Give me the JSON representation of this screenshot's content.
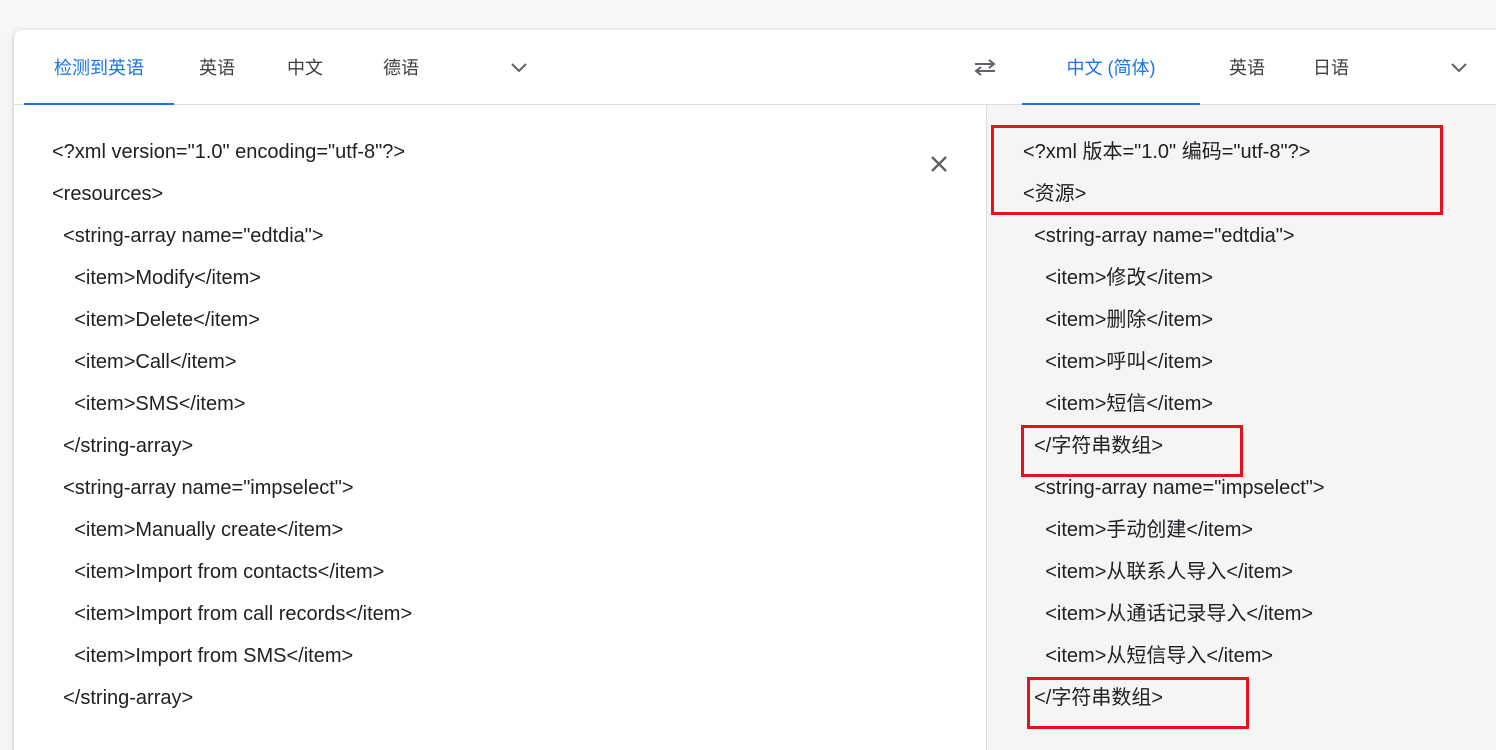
{
  "source_tabs": [
    "检测到英语",
    "英语",
    "中文",
    "德语"
  ],
  "target_tabs": [
    "中文 (简体)",
    "英语",
    "日语"
  ],
  "icons": {
    "source_more": "chevron-down-icon",
    "target_more": "chevron-down-icon",
    "swap": "swap-arrows-icon",
    "clear": "close-icon"
  },
  "colors": {
    "accent": "#1a73e8",
    "highlight": "#e8101a",
    "target_bg": "#f5f5f5"
  },
  "source_lines": [
    "<?xml version=\"1.0\" encoding=\"utf-8\"?>",
    "<resources>",
    "  <string-array name=\"edtdia\">",
    "    <item>Modify</item>",
    "    <item>Delete</item>",
    "    <item>Call</item>",
    "    <item>SMS</item>",
    "  </string-array>",
    "  <string-array name=\"impselect\">",
    "    <item>Manually create</item>",
    "    <item>Import from contacts</item>",
    "    <item>Import from call records</item>",
    "    <item>Import from SMS</item>",
    "  </string-array>"
  ],
  "target_lines": [
    "<?xml 版本=\"1.0\" 编码=\"utf-8\"?>",
    "<资源>",
    "  <string-array name=\"edtdia\">",
    "    <item>修改</item>",
    "    <item>删除</item>",
    "    <item>呼叫</item>",
    "    <item>短信</item>",
    "  </字符串数组>",
    "  <string-array name=\"impselect\">",
    "    <item>手动创建</item>",
    "    <item>从联系人导入</item>",
    "    <item>从通话记录导入</item>",
    "    <item>从短信导入</item>",
    "  </字符串数组>"
  ]
}
